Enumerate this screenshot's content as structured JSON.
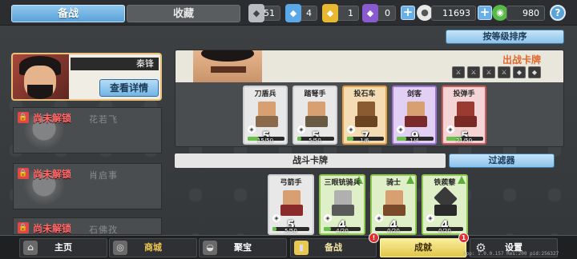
{
  "topbar": {
    "tab_active": "备战",
    "tab_inactive": "收藏",
    "resources": [
      {
        "value": "51",
        "icon": "silver-badge-icon",
        "color": "#b9bcc0"
      },
      {
        "value": "4",
        "icon": "blue-badge-icon",
        "color": "#5aa8e8"
      },
      {
        "value": "1",
        "icon": "gold-badge-icon",
        "color": "#e8b830"
      },
      {
        "value": "0",
        "icon": "purple-badge-icon",
        "color": "#8a5ad0"
      }
    ],
    "gold": "11693",
    "gems": "980",
    "help": "?"
  },
  "hero": {
    "name": "秦锋",
    "detail_button": "查看详情"
  },
  "locked": [
    {
      "label": "尚未解锁",
      "name": "花若飞"
    },
    {
      "label": "尚未解锁",
      "name": "肖启事"
    },
    {
      "label": "尚未解锁",
      "name": "石佛孜"
    }
  ],
  "sort_button": "按等级排序",
  "deck": {
    "title": "出战卡牌",
    "cards": [
      {
        "name": "刀盾兵",
        "cost": "5",
        "progress": "15/50",
        "fill": 0.3,
        "rarity": "common"
      },
      {
        "name": "踏弩手",
        "cost": "5",
        "progress": "5/50",
        "fill": 0.1,
        "rarity": "common"
      },
      {
        "name": "投石车",
        "cost": "7",
        "progress": "1/6",
        "fill": 0.17,
        "rarity": "orange"
      },
      {
        "name": "剑客",
        "cost": "9",
        "progress": "1/4",
        "fill": 0.25,
        "rarity": "purple"
      },
      {
        "name": "投弹手",
        "cost": "5",
        "progress": "21/50",
        "fill": 0.42,
        "rarity": "common"
      }
    ]
  },
  "battle_cards_label": "战斗卡牌",
  "filter_button": "过滤器",
  "battle_cards": [
    {
      "name": "弓箭手",
      "cost": "5",
      "progress": "5/50",
      "fill": 0.1,
      "rarity": "common"
    },
    {
      "name": "三眼铳骑兵",
      "cost": "4",
      "progress": "4/20",
      "fill": 0.2,
      "rarity": "green"
    },
    {
      "name": "骑士",
      "cost": "4",
      "progress": "0/20",
      "fill": 0.0,
      "rarity": "green"
    },
    {
      "name": "铁蒺藜",
      "cost": "4",
      "progress": "0/20",
      "fill": 0.0,
      "rarity": "green"
    }
  ],
  "nav": {
    "home": "主页",
    "shop": "商城",
    "treasure": "聚宝",
    "prepare": "备战",
    "achievement": "成就",
    "settings": "设置",
    "badge_prepare": "!",
    "badge_achievement": "1"
  },
  "version": "App: 1.0.0.157 Res:200 pid:256327"
}
